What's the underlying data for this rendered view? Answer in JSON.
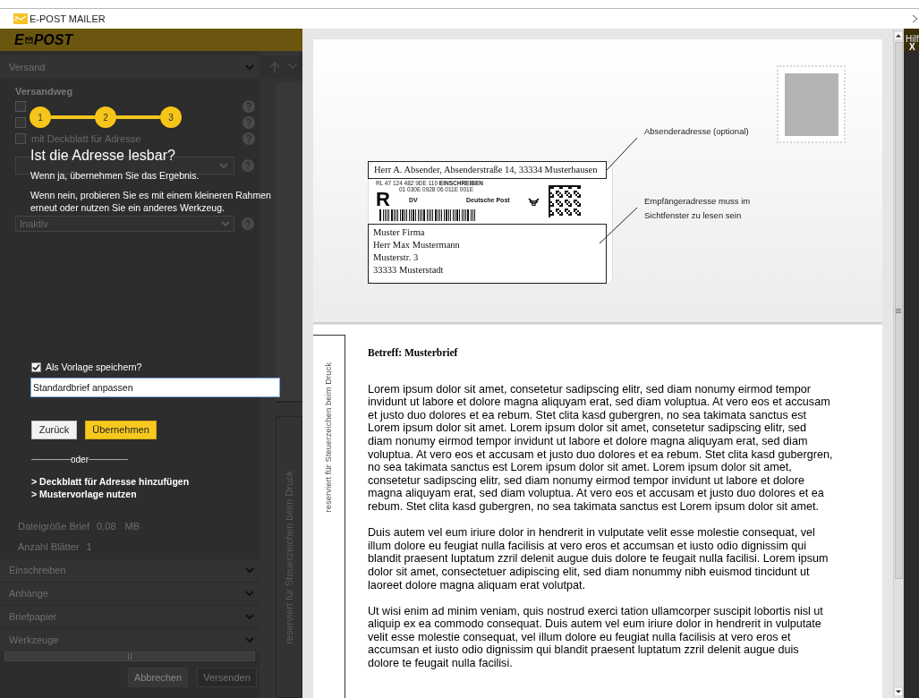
{
  "window": {
    "title": "E-POST MAILER"
  },
  "header": {
    "logo_left": "E",
    "logo_right": "POST"
  },
  "sidebar": {
    "section_title": "Versand",
    "heading": "Versandweg",
    "options": [
      {
        "checked": false
      },
      {
        "checked": false
      },
      {
        "label": "mit Deckblatt für Adresse",
        "checked": false
      }
    ],
    "schedule_select": {
      "value": "Inaktiv"
    },
    "stats": [
      {
        "label": "Dateigröße Brief",
        "value": "0,08",
        "unit": "MB"
      },
      {
        "label": "Anzahl Blätter",
        "value": "1"
      }
    ],
    "sections": [
      {
        "label": "Einschreiben",
        "expanded": false
      },
      {
        "label": "Anhänge",
        "expanded": false
      },
      {
        "label": "Briefpapier",
        "expanded": false
      },
      {
        "label": "Werkzeuge",
        "expanded": false
      }
    ],
    "buttons": [
      {
        "label": "Abbrechen",
        "disabled": false
      },
      {
        "label": "Versenden",
        "disabled": true
      }
    ]
  },
  "tutorial": {
    "steps": [
      "1",
      "2",
      "3"
    ],
    "title": "Ist die Adresse lesbar?",
    "lines": [
      "Wenn ja, übernehmen Sie das Ergebnis.",
      "Wenn nein, probieren Sie es mit einem kleineren Rahmen erneut oder nutzen Sie ein anderes Werkzeug."
    ],
    "save_template": {
      "label": "Als Vorlage speichern?",
      "checked": true
    },
    "template_name": {
      "value": "Standardbrief anpassen"
    },
    "buttons": [
      {
        "label": "Zurück",
        "kind": "secondary"
      },
      {
        "label": "Übernehmen",
        "kind": "primary"
      }
    ],
    "separator": "oder",
    "links": [
      "> Deckblatt für Adresse hinzufügen",
      "> Mustervorlage nutzen"
    ]
  },
  "strip": {
    "margin_note": "reserviert für Steuerzeichen beim Druck"
  },
  "letter": {
    "sender_line": "Herr A. Absender, Absenderstraße 14, 33334 Musterhausen",
    "code_line_1": "RL 47 124 482 9DE 110 **EINSCHREIBEN**",
    "code_line_2": "01 030E 0928 06 011E 001E",
    "mark": "R",
    "product": "DV",
    "carrier": "Deutsche Post",
    "recipient_lines": [
      "Muster Firma",
      "Herr Max Mustermann",
      "Musterstr. 3",
      "33333 Musterstadt"
    ],
    "annotations": [
      "Absenderadresse (optional)",
      "Empfängeradresse muss im Sichtfenster zu lesen sein"
    ],
    "margin_note": "reserviert für Steuerzeichen beim Druck",
    "subject": "Betreff: Musterbrief",
    "paragraphs": [
      "Lorem ipsum dolor sit amet, consetetur sadipscing elitr, sed diam nonumy eirmod tempor invidunt ut labore et dolore magna aliquyam erat, sed diam voluptua. At vero eos et accusam et justo duo dolores et ea rebum. Stet clita kasd gubergren, no sea takimata sanctus est Lorem ipsum dolor sit amet. Lorem ipsum dolor sit amet, consetetur sadipscing elitr, sed diam nonumy eirmod tempor invidunt ut labore et dolore magna aliquyam erat, sed diam voluptua. At vero eos et accusam et justo duo dolores et ea rebum. Stet clita kasd gubergren, no sea takimata sanctus est Lorem ipsum dolor sit amet. Lorem ipsum dolor sit amet, consetetur sadipscing elitr, sed diam nonumy eirmod tempor invidunt ut labore et dolore magna aliquyam erat, sed diam voluptua. At vero eos et accusam et justo duo dolores et ea rebum. Stet clita kasd gubergren, no sea takimata sanctus est Lorem ipsum dolor sit amet.",
      "Duis autem vel eum iriure dolor in hendrerit in vulputate velit esse molestie consequat, vel illum dolore eu feugiat nulla facilisis at vero eros et accumsan et iusto odio dignissim qui blandit praesent luptatum zzril delenit augue duis dolore te feugait nulla facilisi. Lorem ipsum dolor sit amet, consectetuer adipiscing elit, sed diam nonummy nibh euismod tincidunt ut laoreet dolore magna aliquam erat volutpat.",
      "Ut wisi enim ad minim veniam, quis nostrud exerci tation ullamcorper suscipit lobortis nisl ut aliquip ex ea commodo consequat. Duis autem vel eum iriure dolor in hendrerit in vulputate velit esse molestie consequat, vel illum dolore eu feugiat nulla facilisis at vero eros et accumsan et iusto odio dignissim qui blandit praesent luptatum zzril delenit augue duis dolore te feugait nulla facilisi."
    ]
  },
  "help_panel": {
    "label": "Hilf",
    "close": "X"
  }
}
